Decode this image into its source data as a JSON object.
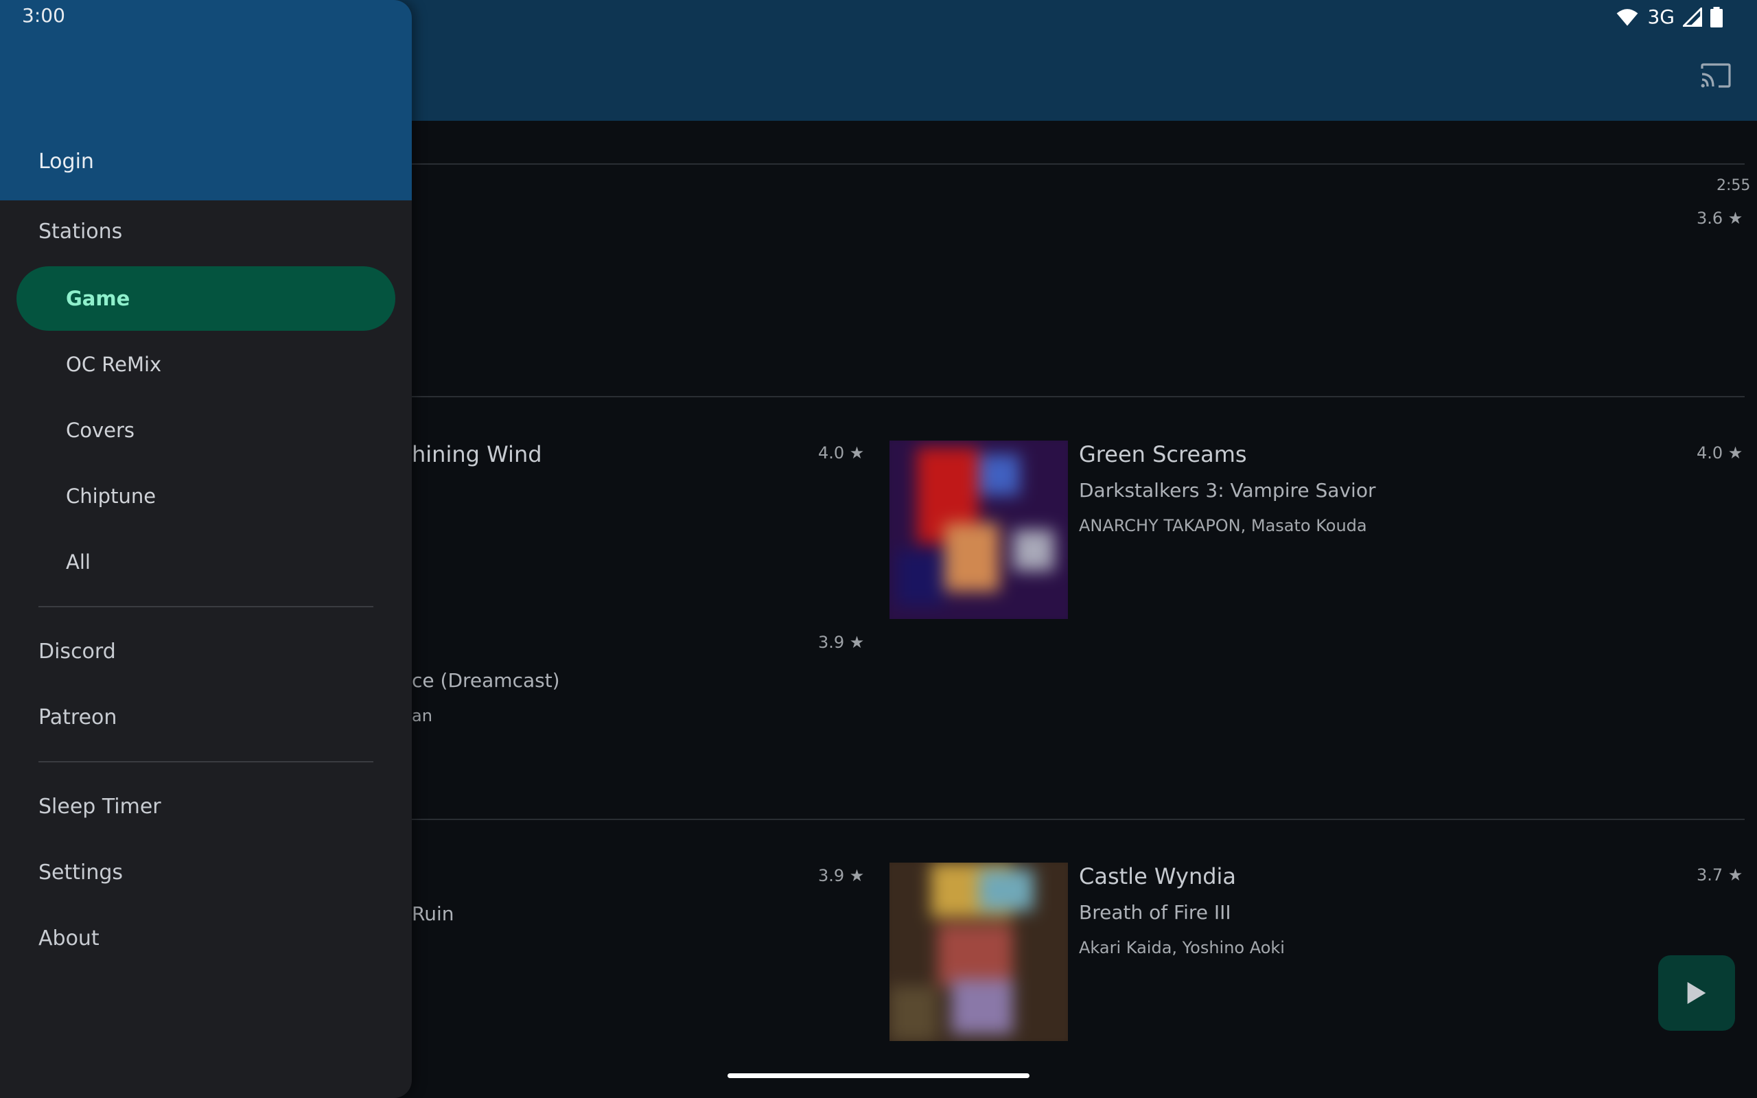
{
  "status_bar": {
    "time": "3:00",
    "network": "3G"
  },
  "drawer": {
    "login_label": "Login",
    "stations_label": "Stations",
    "stations": [
      "Game",
      "OC ReMix",
      "Covers",
      "Chiptune",
      "All"
    ],
    "active_station": "Game",
    "links": [
      "Discord",
      "Patreon"
    ],
    "utilities": [
      "Sleep Timer",
      "Settings",
      "About"
    ]
  },
  "content": {
    "now_playing": {
      "time": "2:55",
      "rating": "3.6 ★"
    },
    "rows": [
      {
        "left": {
          "title": "hining Wind",
          "rating": "4.0 ★"
        },
        "right": {
          "title": "Green Screams",
          "game": "Darkstalkers 3: Vampire Savior",
          "artists": "ANARCHY TAKAPON, Masato Kouda",
          "rating": "4.0 ★"
        }
      },
      {
        "left": {
          "game": "ce (Dreamcast)",
          "artists": "an",
          "rating": "3.9 ★"
        }
      },
      {
        "left": {
          "game": "Ruin",
          "rating": "3.9 ★"
        },
        "right": {
          "title": "Castle Wyndia",
          "game": "Breath of Fire III",
          "artists": "Akari Kaida, Yoshino Aoki",
          "rating": "3.7 ★"
        }
      }
    ]
  },
  "colors": {
    "appbar": "#0e3552",
    "drawer_header": "#124b78",
    "active_item": "#04543f",
    "active_text": "#8ff0cc",
    "fab": "#063c33"
  }
}
